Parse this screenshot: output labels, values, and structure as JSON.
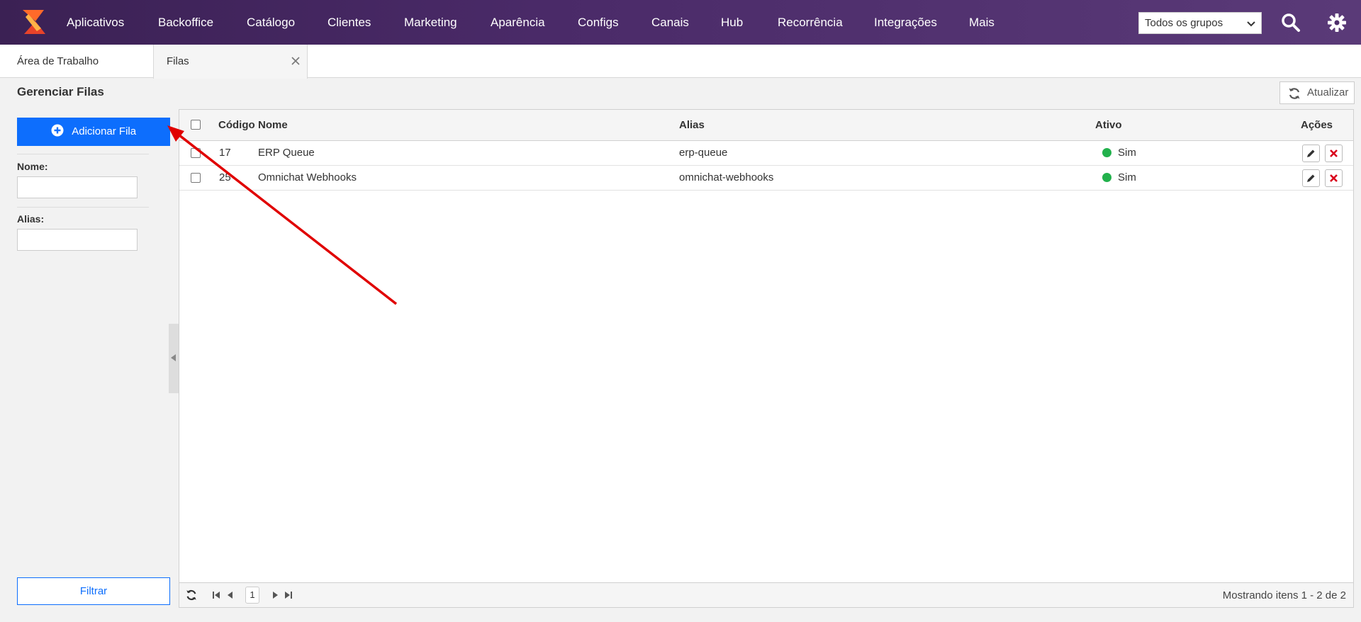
{
  "nav": {
    "items": [
      "Aplicativos",
      "Backoffice",
      "Catálogo",
      "Clientes",
      "Marketing",
      "Aparência",
      "Configs",
      "Canais",
      "Hub",
      "Recorrência",
      "Integrações",
      "Mais"
    ],
    "group_select": "Todos os grupos",
    "icons": [
      "search-icon",
      "gear-icon"
    ]
  },
  "tabs": {
    "home": "Área de Trabalho",
    "active": "Filas"
  },
  "page": {
    "title": "Gerenciar Filas",
    "refresh_label": "Atualizar"
  },
  "filters": {
    "add_label": "Adicionar Fila",
    "name_label": "Nome:",
    "name_value": "",
    "alias_label": "Alias:",
    "alias_value": "",
    "filter_label": "Filtrar"
  },
  "grid": {
    "columns": [
      "Código",
      "Nome",
      "Alias",
      "Ativo",
      "Ações"
    ],
    "rows": [
      {
        "code": "17",
        "name": "ERP Queue",
        "alias": "erp-queue",
        "active": "Sim"
      },
      {
        "code": "25",
        "name": "Omnichat Webhooks",
        "alias": "omnichat-webhooks",
        "active": "Sim"
      }
    ],
    "current_page": "1",
    "info": "Mostrando itens 1 - 2 de 2"
  },
  "colors": {
    "nav_bg": "#4a2a68",
    "primary": "#0d6efd",
    "active_green": "#22b14c",
    "delete_red": "#d9001b",
    "annotation_arrow": "#e00000"
  }
}
